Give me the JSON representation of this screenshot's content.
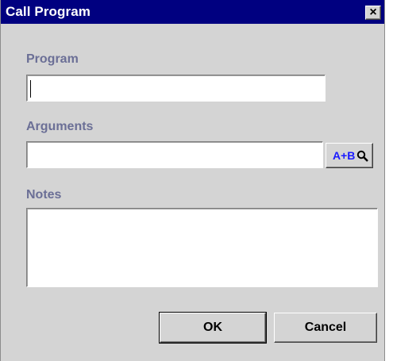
{
  "window": {
    "title": "Call Program",
    "close_glyph": "×"
  },
  "form": {
    "program_label": "Program",
    "program_value": "",
    "arguments_label": "Arguments",
    "arguments_value": "",
    "expression_button_label": "A+B",
    "expression_button_icon": "magnifier-icon",
    "notes_label": "Notes",
    "notes_value": ""
  },
  "buttons": {
    "ok_label": "OK",
    "cancel_label": "Cancel"
  },
  "colors": {
    "titlebar": "#000080",
    "label": "#6b6f96",
    "expression_text": "#1a1aff",
    "dialog_bg": "#d4d4d4"
  }
}
